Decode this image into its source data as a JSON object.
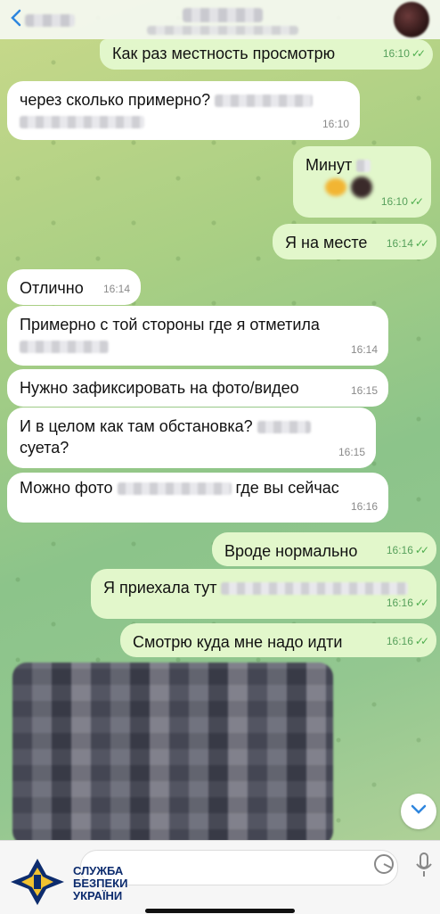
{
  "header": {
    "back_label": "Назад"
  },
  "messages": [
    {
      "dir": "out",
      "text": "Как раз местность просмотрю",
      "time": "16:10",
      "read": true
    },
    {
      "dir": "in",
      "text": "через сколько примерно?",
      "time": "16:10"
    },
    {
      "dir": "out",
      "text": "Минут",
      "time": "16:10",
      "read": true
    },
    {
      "dir": "out",
      "text": "Я на месте",
      "time": "16:14",
      "read": true
    },
    {
      "dir": "in",
      "text": "Отлично",
      "time": "16:14"
    },
    {
      "dir": "in",
      "text": "Примерно с той стороны где я отметила",
      "time": "16:14"
    },
    {
      "dir": "in",
      "text": "Нужно зафиксировать на фото/видео",
      "time": "16:15"
    },
    {
      "dir": "in",
      "text": "И в целом как там обстановка?",
      "text2": "суета?",
      "time": "16:15"
    },
    {
      "dir": "in",
      "text": "Можно фото",
      "text2": "где вы сейчас",
      "time": "16:16"
    },
    {
      "dir": "out",
      "text": "Вроде нормально",
      "time": "16:16",
      "read": true
    },
    {
      "dir": "out",
      "text": "Я приехала тут",
      "time": "16:16",
      "read": true
    },
    {
      "dir": "out",
      "text": "Смотрю куда мне надо идти",
      "time": "16:16",
      "read": true
    }
  ],
  "watermark": {
    "line1": "СЛУЖБА",
    "line2": "БЕЗПЕКИ",
    "line3": "УКРАЇНИ"
  },
  "colors": {
    "incoming_bubble": "#ffffff",
    "outgoing_bubble": "#e2f7cb",
    "accent": "#2e86de",
    "read_ticks": "#4fae4e"
  }
}
